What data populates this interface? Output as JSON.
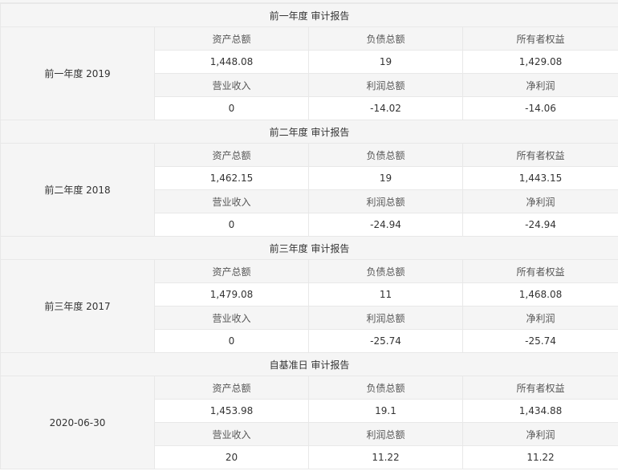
{
  "sections": [
    {
      "title": "前一年度 审计报告",
      "period": "前一年度 2019",
      "row1_labels": [
        "资产总额",
        "负债总额",
        "所有者权益"
      ],
      "row1_values": [
        "1,448.08",
        "19",
        "1,429.08"
      ],
      "row2_labels": [
        "营业收入",
        "利润总额",
        "净利润"
      ],
      "row2_values": [
        "0",
        "-14.02",
        "-14.06"
      ]
    },
    {
      "title": "前二年度 审计报告",
      "period": "前二年度 2018",
      "row1_labels": [
        "资产总额",
        "负债总额",
        "所有者权益"
      ],
      "row1_values": [
        "1,462.15",
        "19",
        "1,443.15"
      ],
      "row2_labels": [
        "营业收入",
        "利润总额",
        "净利润"
      ],
      "row2_values": [
        "0",
        "-24.94",
        "-24.94"
      ]
    },
    {
      "title": "前三年度 审计报告",
      "period": "前三年度 2017",
      "row1_labels": [
        "资产总额",
        "负债总额",
        "所有者权益"
      ],
      "row1_values": [
        "1,479.08",
        "11",
        "1,468.08"
      ],
      "row2_labels": [
        "营业收入",
        "利润总额",
        "净利润"
      ],
      "row2_values": [
        "0",
        "-25.74",
        "-25.74"
      ]
    },
    {
      "title": "自基准日 审计报告",
      "period": "2020-06-30",
      "row1_labels": [
        "资产总额",
        "负债总额",
        "所有者权益"
      ],
      "row1_values": [
        "1,453.98",
        "19.1",
        "1,434.88"
      ],
      "row2_labels": [
        "营业收入",
        "利润总额",
        "净利润"
      ],
      "row2_values": [
        "20",
        "11.22",
        "11.22"
      ]
    }
  ]
}
